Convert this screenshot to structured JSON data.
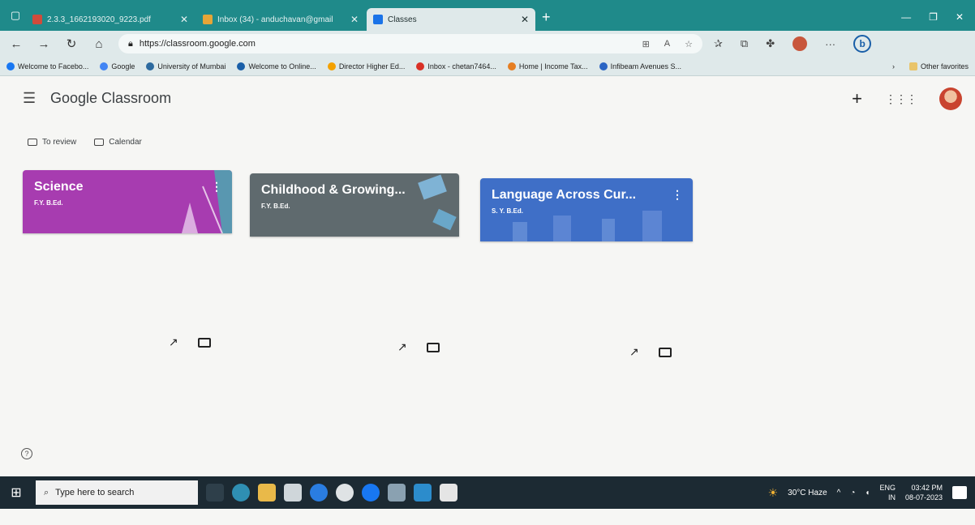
{
  "browser": {
    "tabs": [
      {
        "label": "2.3.3_1662193020_9223.pdf",
        "color": "#d04b3b",
        "active": false
      },
      {
        "label": "Inbox (34) - anduchavan@gmail",
        "color": "#e6a537",
        "active": false
      },
      {
        "label": "Classes",
        "color": "#1a73e8",
        "active": true
      }
    ],
    "url": "https://classroom.google.com",
    "favorites": [
      {
        "label": "Welcome to Facebo...",
        "color": "#1877f2"
      },
      {
        "label": "Google",
        "color": "#4285f4"
      },
      {
        "label": "University of Mumbai",
        "color": "#2d6a9f"
      },
      {
        "label": "Welcome to Online...",
        "color": "#1a5fa8"
      },
      {
        "label": "Director Higher Ed...",
        "color": "#f4a100"
      },
      {
        "label": "Inbox - chetan7464...",
        "color": "#d93025"
      },
      {
        "label": "Home | Income Tax...",
        "color": "#e67e22"
      },
      {
        "label": "Infibeam Avenues S...",
        "color": "#2b65c4"
      }
    ],
    "other_favorites": "Other favorites"
  },
  "classroom": {
    "logo": "Google Classroom",
    "subnav": {
      "to_review": "To review",
      "calendar": "Calendar"
    },
    "cards": [
      {
        "title": "Science",
        "subtitle": "F.Y. B.Ed.",
        "color": "#a73cb0"
      },
      {
        "title": "Childhood & Growing...",
        "subtitle": "F.Y. B.Ed.",
        "color": "#5f6a6e"
      },
      {
        "title": "Language Across Cur...",
        "subtitle": "S. Y. B.Ed.",
        "color": "#3f6fc7"
      }
    ]
  },
  "taskbar": {
    "search_placeholder": "Type here to search",
    "weather": "30°C  Haze",
    "lang": "ENG",
    "region": "IN",
    "time": "03:42 PM",
    "date": "08-07-2023"
  }
}
